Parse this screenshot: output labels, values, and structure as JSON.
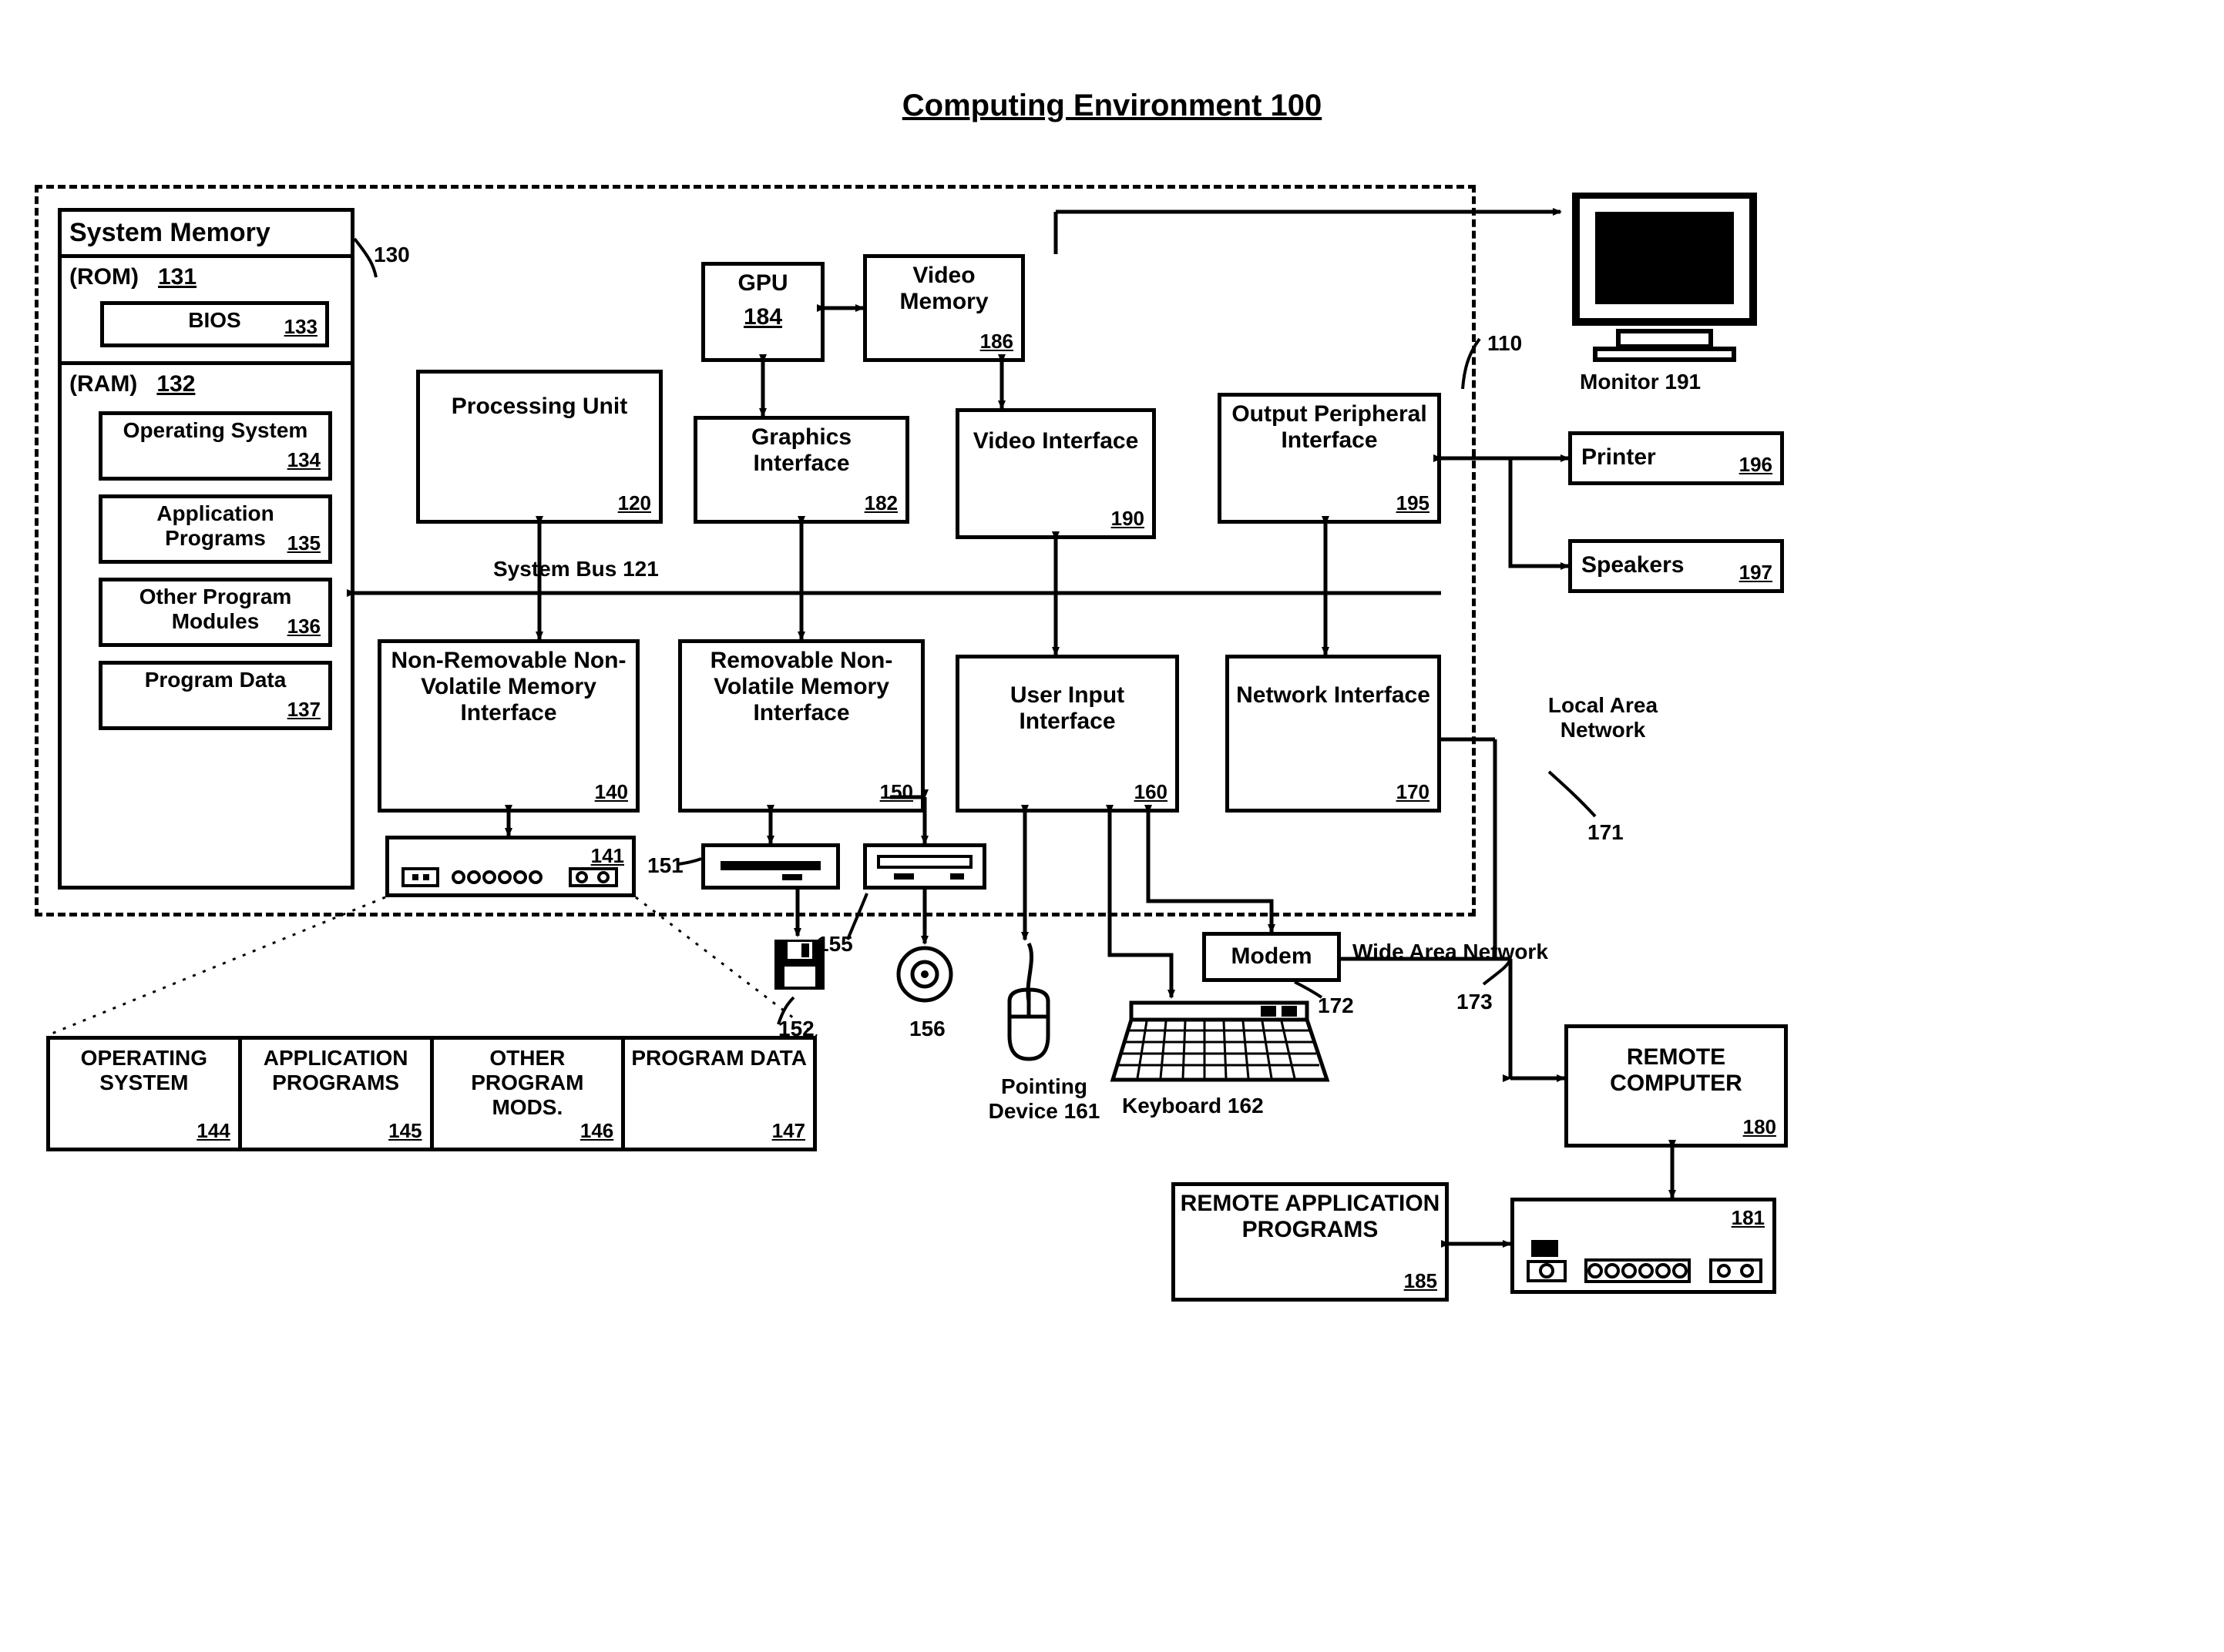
{
  "title": "Computing Environment 100",
  "boundary_ref": "110",
  "system_memory": {
    "header": "System Memory",
    "ref": "130",
    "rom": {
      "label": "(ROM)",
      "ref": "131",
      "bios": {
        "label": "BIOS",
        "ref": "133"
      }
    },
    "ram": {
      "label": "(RAM)",
      "ref": "132",
      "items": [
        {
          "label": "Operating System",
          "ref": "134"
        },
        {
          "label": "Application Programs",
          "ref": "135"
        },
        {
          "label": "Other Program Modules",
          "ref": "136"
        },
        {
          "label": "Program Data",
          "ref": "137"
        }
      ]
    }
  },
  "blocks": {
    "processing_unit": {
      "label": "Processing Unit",
      "ref": "120"
    },
    "gpu": {
      "label": "GPU",
      "ref": "184"
    },
    "video_memory": {
      "label": "Video Memory",
      "ref": "186"
    },
    "graphics_interface": {
      "label": "Graphics Interface",
      "ref": "182"
    },
    "video_interface": {
      "label": "Video Interface",
      "ref": "190"
    },
    "output_periph": {
      "label": "Output Peripheral Interface",
      "ref": "195"
    },
    "nonremovable": {
      "label": "Non-Removable Non-Volatile Memory Interface",
      "ref": "140"
    },
    "removable": {
      "label": "Removable Non-Volatile Memory Interface",
      "ref": "150"
    },
    "user_input": {
      "label": "User Input Interface",
      "ref": "160"
    },
    "network_if": {
      "label": "Network Interface",
      "ref": "170"
    },
    "modem": {
      "label": "Modem",
      "ref": "172"
    },
    "remote_computer": {
      "label": "REMOTE COMPUTER",
      "ref": "180"
    },
    "remote_apps": {
      "label": "REMOTE APPLICATION PROGRAMS",
      "ref": "185"
    }
  },
  "bus_label": "System Bus 121",
  "peripherals": {
    "monitor": "Monitor 191",
    "printer": {
      "label": "Printer",
      "ref": "196"
    },
    "speakers": {
      "label": "Speakers",
      "ref": "197"
    },
    "keyboard": "Keyboard 162",
    "pointing_device": "Pointing Device 161"
  },
  "networks": {
    "lan": "Local Area Network",
    "lan_ref": "171",
    "wan": "Wide Area Network",
    "wan_ref": "173"
  },
  "storage_icons": {
    "hdd_ref": "141",
    "floppy_drive_ref": "151",
    "floppy_ref": "152",
    "cd_drive_ref": "155",
    "disc_ref": "156",
    "remote_drive_ref": "181"
  },
  "hdd_contents": [
    {
      "label": "OPERATING SYSTEM",
      "ref": "144"
    },
    {
      "label": "APPLICATION PROGRAMS",
      "ref": "145"
    },
    {
      "label": "OTHER PROGRAM MODS.",
      "ref": "146"
    },
    {
      "label": "PROGRAM DATA",
      "ref": "147"
    }
  ]
}
